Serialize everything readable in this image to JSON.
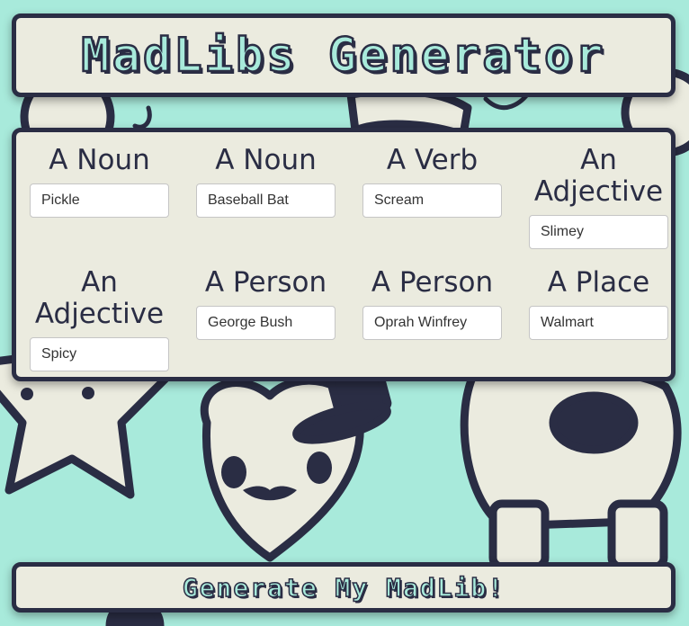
{
  "header": {
    "title": "MadLibs Generator"
  },
  "form": {
    "fields": [
      {
        "label": "A Noun",
        "value": "Pickle"
      },
      {
        "label": "A Noun",
        "value": "Baseball Bat"
      },
      {
        "label": "A Verb",
        "value": "Scream"
      },
      {
        "label": "An Adjective",
        "value": "Slimey"
      },
      {
        "label": "An Adjective",
        "value": "Spicy"
      },
      {
        "label": "A Person",
        "value": "George Bush"
      },
      {
        "label": "A Person",
        "value": "Oprah Winfrey"
      },
      {
        "label": "A Place",
        "value": "Walmart"
      }
    ]
  },
  "actions": {
    "generate_label": "Generate My MadLib!"
  },
  "colors": {
    "background": "#a8eadb",
    "panel": "#ebebdf",
    "ink": "#2a2d44"
  }
}
